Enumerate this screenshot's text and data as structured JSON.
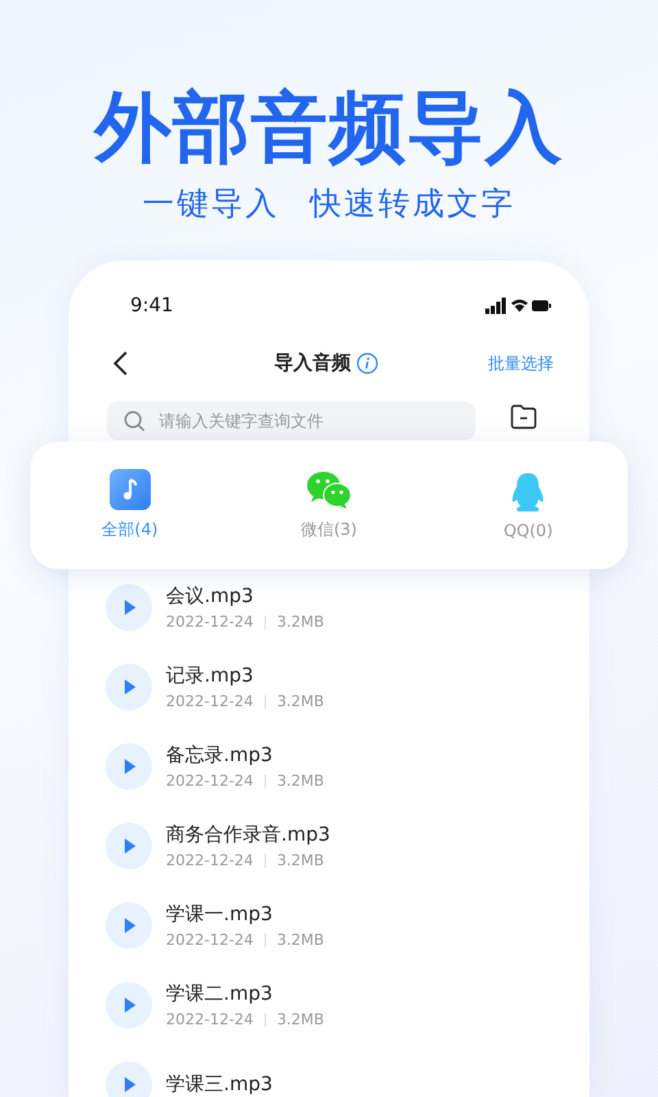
{
  "headline": "外部音频导入",
  "subheadline": [
    "一键导入",
    "快速转成文字"
  ],
  "status_bar": {
    "time": "9:41"
  },
  "nav": {
    "title": "导入音频",
    "action": "批量选择"
  },
  "search": {
    "placeholder": "请输入关键字查询文件"
  },
  "source_tabs": [
    {
      "label": "全部(4)",
      "selected": true,
      "kind": "music"
    },
    {
      "label": "微信(3)",
      "selected": false,
      "kind": "wechat"
    },
    {
      "label": "QQ(0)",
      "selected": false,
      "kind": "qq"
    }
  ],
  "files": [
    {
      "name": "会议.mp3",
      "date": "2022-12-24",
      "size": "3.2MB"
    },
    {
      "name": "记录.mp3",
      "date": "2022-12-24",
      "size": "3.2MB"
    },
    {
      "name": "备忘录.mp3",
      "date": "2022-12-24",
      "size": "3.2MB"
    },
    {
      "name": "商务合作录音.mp3",
      "date": "2022-12-24",
      "size": "3.2MB"
    },
    {
      "name": "学课一.mp3",
      "date": "2022-12-24",
      "size": "3.2MB"
    },
    {
      "name": "学课二.mp3",
      "date": "2022-12-24",
      "size": "3.2MB"
    },
    {
      "name": "学课三.mp3"
    }
  ]
}
